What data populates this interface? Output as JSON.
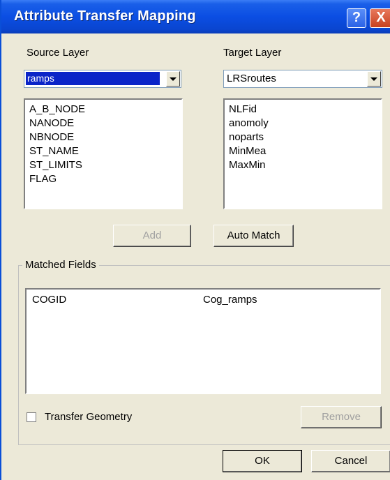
{
  "window": {
    "title": "Attribute Transfer Mapping",
    "help_glyph": "?",
    "close_glyph": "X"
  },
  "source": {
    "label": "Source Layer",
    "selected": "ramps",
    "fields": [
      "A_B_NODE",
      "NANODE",
      "NBNODE",
      "ST_NAME",
      "ST_LIMITS",
      "FLAG"
    ]
  },
  "target": {
    "label": "Target Layer",
    "selected": "LRSroutes",
    "fields": [
      "NLFid",
      "anomoly",
      "noparts",
      "MinMea",
      "MaxMin"
    ]
  },
  "buttons": {
    "add": "Add",
    "auto_match": "Auto Match",
    "remove": "Remove",
    "ok": "OK",
    "cancel": "Cancel"
  },
  "matched": {
    "label": "Matched Fields",
    "rows": [
      {
        "source": "COGID",
        "target": "Cog_ramps"
      }
    ]
  },
  "transfer_geometry": {
    "label": "Transfer Geometry",
    "checked": false
  }
}
